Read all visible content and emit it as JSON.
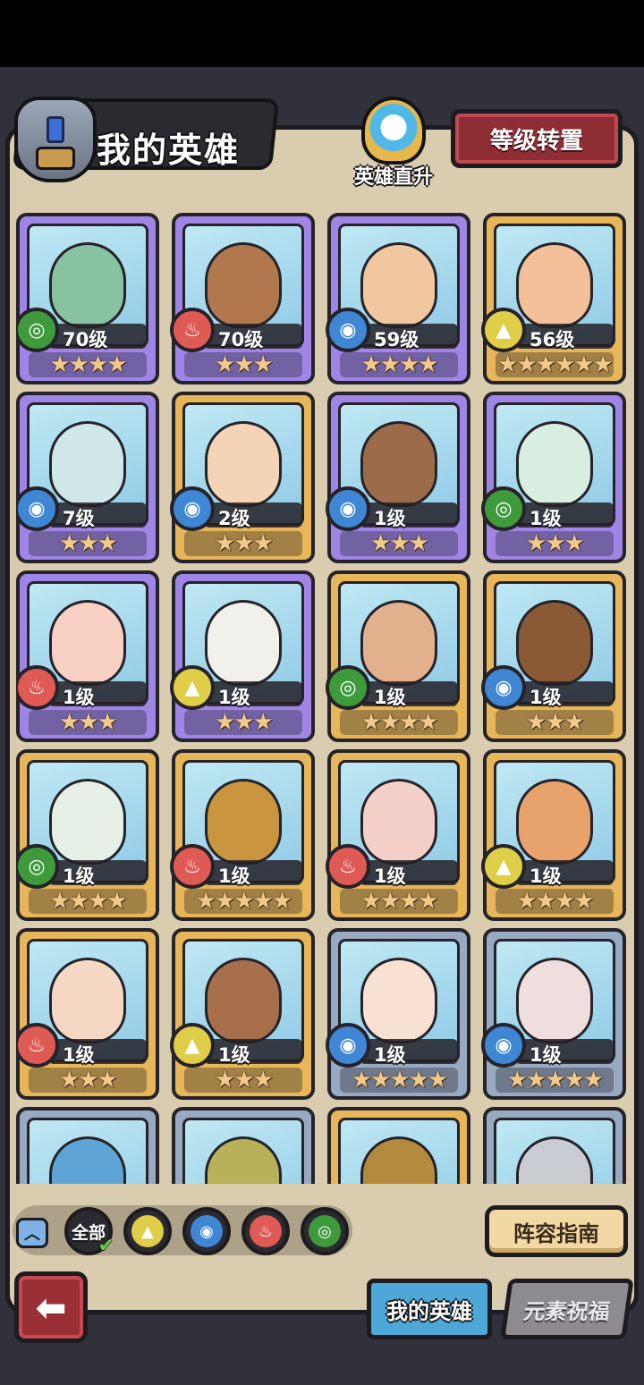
{
  "header": {
    "title": "我的英雄",
    "direct_upgrade_label": "英雄直升",
    "level_reset_label": "等级转置"
  },
  "heroes": [
    {
      "level": "70级",
      "element": "wood",
      "rarity": "purple",
      "stars": "★★★★",
      "star_count": 4,
      "face": "#88c2a2"
    },
    {
      "level": "70级",
      "element": "fire",
      "rarity": "purple",
      "stars": "★★★",
      "star_count": 3,
      "face": "#b0784c"
    },
    {
      "level": "59级",
      "element": "water",
      "rarity": "purple",
      "stars": "★★★★",
      "star_count": 4,
      "face": "#f1c7a0"
    },
    {
      "level": "56级",
      "element": "earth",
      "rarity": "gold",
      "stars": "★★★★★★",
      "star_count": 6,
      "face": "#f3c09a"
    },
    {
      "level": "7级",
      "element": "water",
      "rarity": "purple",
      "stars": "★★★",
      "star_count": 3,
      "face": "#cfe7e8"
    },
    {
      "level": "2级",
      "element": "water",
      "rarity": "gold",
      "stars": "★★★",
      "star_count": 3,
      "face": "#f4d3b7"
    },
    {
      "level": "1级",
      "element": "water",
      "rarity": "purple",
      "stars": "★★★",
      "star_count": 3,
      "face": "#9c6b4a"
    },
    {
      "level": "1级",
      "element": "wood",
      "rarity": "purple",
      "stars": "★★★",
      "star_count": 3,
      "face": "#d8eee0"
    },
    {
      "level": "1级",
      "element": "fire",
      "rarity": "purple",
      "stars": "★★★",
      "star_count": 3,
      "face": "#f8d0c4"
    },
    {
      "level": "1级",
      "element": "earth",
      "rarity": "purple",
      "stars": "★★★",
      "star_count": 3,
      "face": "#f2f0ea"
    },
    {
      "level": "1级",
      "element": "wood",
      "rarity": "gold",
      "stars": "★★★★",
      "star_count": 4,
      "face": "#e3b08e"
    },
    {
      "level": "1级",
      "element": "water",
      "rarity": "gold",
      "stars": "★★★",
      "star_count": 3,
      "face": "#8a5a36"
    },
    {
      "level": "1级",
      "element": "wood",
      "rarity": "gold",
      "stars": "★★★★",
      "star_count": 4,
      "face": "#e6f0e6"
    },
    {
      "level": "1级",
      "element": "fire",
      "rarity": "gold",
      "stars": "★★★★★",
      "star_count": 5,
      "face": "#c9953e"
    },
    {
      "level": "1级",
      "element": "fire",
      "rarity": "gold",
      "stars": "★★★★",
      "star_count": 4,
      "face": "#f4cfc8"
    },
    {
      "level": "1级",
      "element": "earth",
      "rarity": "gold",
      "stars": "★★★★",
      "star_count": 4,
      "face": "#e8a26b"
    },
    {
      "level": "1级",
      "element": "fire",
      "rarity": "gold",
      "stars": "★★★",
      "star_count": 3,
      "face": "#f5d8c4"
    },
    {
      "level": "1级",
      "element": "earth",
      "rarity": "gold",
      "stars": "★★★",
      "star_count": 3,
      "face": "#a8704a"
    },
    {
      "level": "1级",
      "element": "water",
      "rarity": "blue",
      "stars": "★★★★★",
      "star_count": 5,
      "face": "#f8e1d2"
    },
    {
      "level": "1级",
      "element": "water",
      "rarity": "blue",
      "stars": "★★★★★",
      "star_count": 5,
      "face": "#f0dede"
    },
    {
      "level": "",
      "element": "",
      "rarity": "blue",
      "stars": "",
      "star_count": 0,
      "face": "#5ea4d6"
    },
    {
      "level": "",
      "element": "",
      "rarity": "blue",
      "stars": "",
      "star_count": 0,
      "face": "#b9b05a"
    },
    {
      "level": "",
      "element": "",
      "rarity": "gold",
      "stars": "",
      "star_count": 0,
      "face": "#b48a3e"
    },
    {
      "level": "",
      "element": "",
      "rarity": "blue",
      "stars": "",
      "star_count": 0,
      "face": "#c9ccd2"
    }
  ],
  "filters": {
    "all_label": "全部",
    "elements": [
      "earth",
      "water",
      "fire",
      "wood"
    ]
  },
  "element_colors": {
    "wood": "#3f9a3c",
    "fire": "#e05a55",
    "water": "#3f86d4",
    "earth": "#e0cd48"
  },
  "element_glyphs": {
    "wood": "◎",
    "fire": "♨",
    "water": "◉",
    "earth": "▲"
  },
  "footer": {
    "guide_label": "阵容指南",
    "tabs": [
      {
        "label": "我的英雄",
        "active": true
      },
      {
        "label": "元素祝福",
        "active": false
      }
    ]
  }
}
